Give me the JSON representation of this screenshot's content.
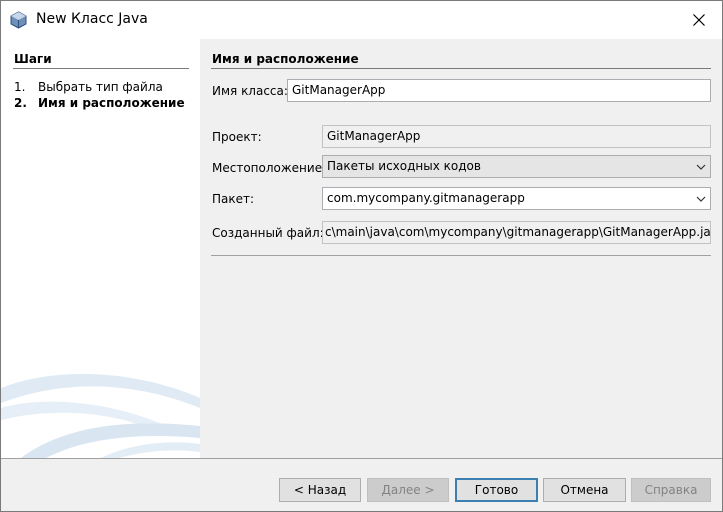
{
  "window": {
    "title": "New Класс Java"
  },
  "steps": {
    "heading": "Шаги",
    "items": [
      {
        "num": "1.",
        "label": "Выбрать тип файла"
      },
      {
        "num": "2.",
        "label": "Имя и расположение"
      }
    ]
  },
  "panel": {
    "heading": "Имя и расположение",
    "class_name": {
      "label": "Имя класса:",
      "value": "GitManagerApp"
    },
    "project": {
      "label": "Проект:",
      "value": "GitManagerApp"
    },
    "location": {
      "label": "Местоположение:",
      "value": "Пакеты исходных кодов"
    },
    "package": {
      "label": "Пакет:",
      "value": "com.mycompany.gitmanagerapp"
    },
    "created_file": {
      "label": "Созданный файл:",
      "value": "c\\main\\java\\com\\mycompany\\gitmanagerapp\\GitManagerApp.java"
    }
  },
  "buttons": {
    "back": "< Назад",
    "next": "Далее >",
    "finish": "Готово",
    "cancel": "Отмена",
    "help": "Справка"
  },
  "icons": {
    "app": "java-cup-icon",
    "close": "close-icon",
    "dropdown": "chevron-down-icon"
  },
  "colors": {
    "default_button_border": "#3c7fb1",
    "disabled_text": "#838383"
  }
}
